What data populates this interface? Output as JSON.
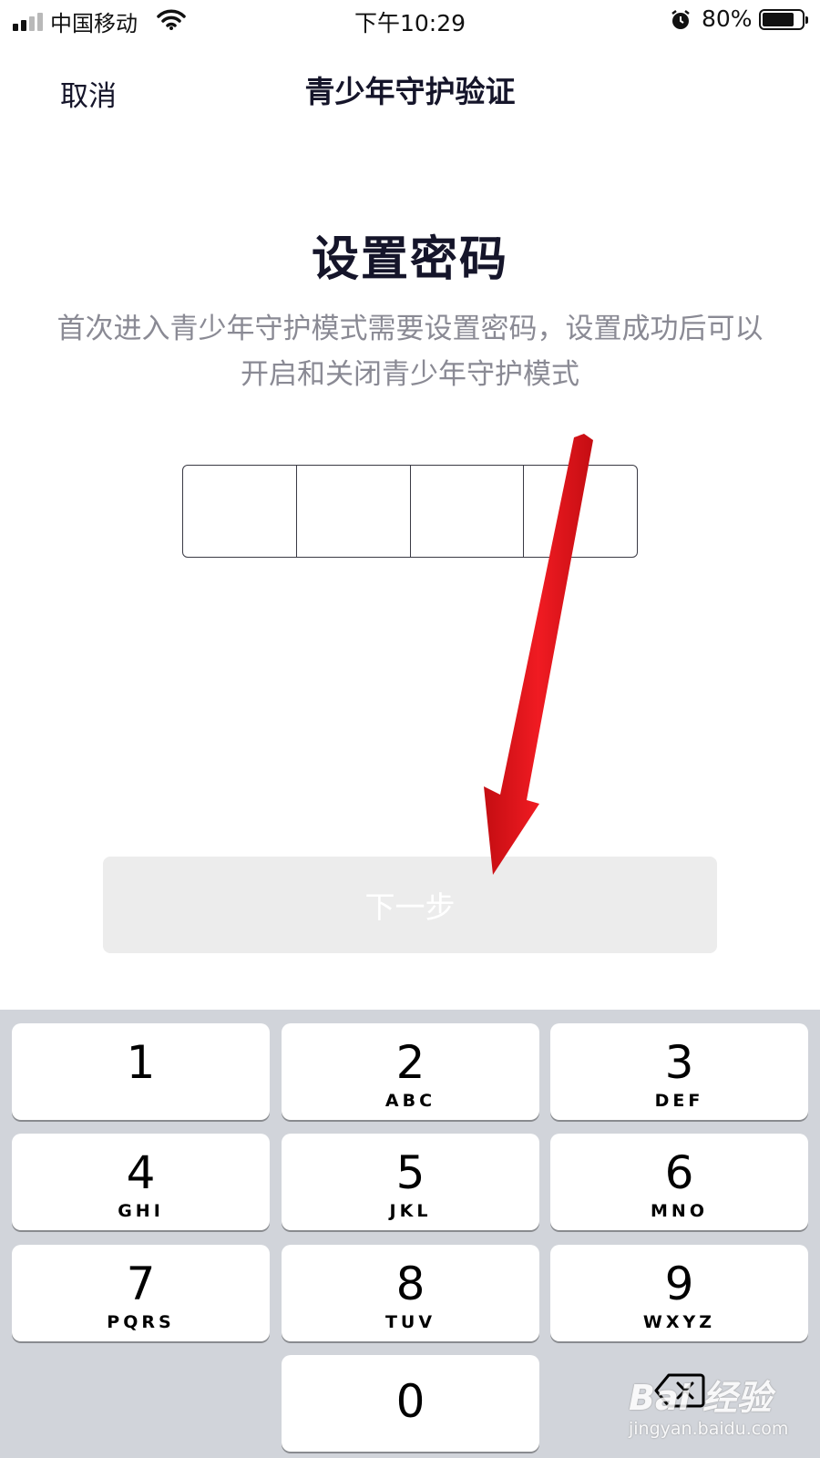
{
  "status_bar": {
    "carrier": "中国移动",
    "time": "下午10:29",
    "battery_percent": "80%",
    "battery_level": 0.8
  },
  "nav": {
    "cancel_label": "取消",
    "title": "青少年守护验证"
  },
  "main": {
    "heading": "设置密码",
    "description_line1": "首次进入青少年守护模式需要设置密码，设置成功后可以",
    "description_line2": "开启和关闭青少年守护模式",
    "pin_cells": [
      "",
      "",
      "",
      ""
    ],
    "next_label": "下一步"
  },
  "keyboard": {
    "keys": [
      {
        "num": "1",
        "letters": ""
      },
      {
        "num": "2",
        "letters": "ABC"
      },
      {
        "num": "3",
        "letters": "DEF"
      },
      {
        "num": "4",
        "letters": "GHI"
      },
      {
        "num": "5",
        "letters": "JKL"
      },
      {
        "num": "6",
        "letters": "MNO"
      },
      {
        "num": "7",
        "letters": "PQRS"
      },
      {
        "num": "8",
        "letters": "TUV"
      },
      {
        "num": "9",
        "letters": "WXYZ"
      },
      {
        "num": "0",
        "letters": ""
      }
    ]
  },
  "watermark": {
    "brand": "Bai 经验",
    "url": "jingyan.baidu.com"
  },
  "colors": {
    "arrow": "#e8141b",
    "keyboard_bg": "#d1d4da",
    "button_disabled": "#ececec",
    "text_primary": "#15152a",
    "text_secondary": "#8a8a94"
  }
}
